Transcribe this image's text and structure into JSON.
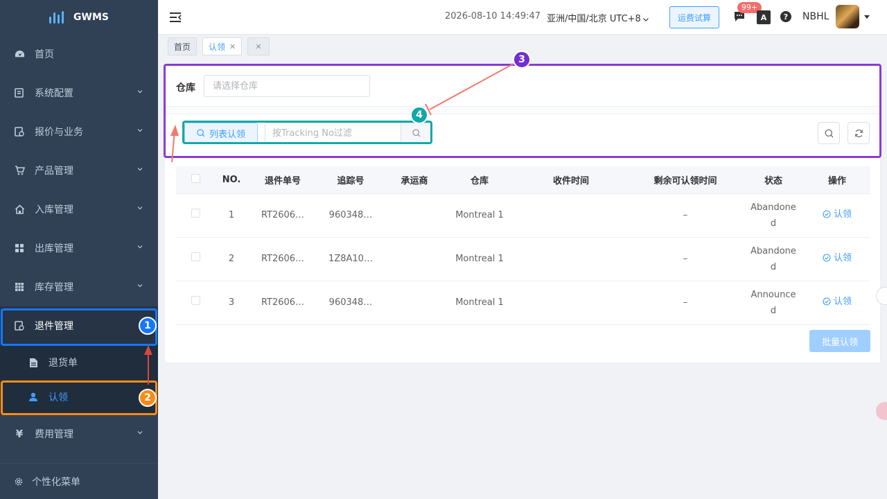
{
  "app": {
    "name": "GWMS"
  },
  "sidebar": {
    "items": [
      {
        "label": "首页",
        "icon": "dashboard-icon"
      },
      {
        "label": "系统配置",
        "icon": "config-icon"
      },
      {
        "label": "报价与业务",
        "icon": "quote-icon"
      },
      {
        "label": "产品管理",
        "icon": "cart-icon"
      },
      {
        "label": "入库管理",
        "icon": "home-icon"
      },
      {
        "label": "出库管理",
        "icon": "grid-icon"
      },
      {
        "label": "库存管理",
        "icon": "table-icon"
      },
      {
        "label": "退件管理",
        "icon": "return-icon"
      },
      {
        "label": "费用管理",
        "icon": "yen-icon"
      }
    ],
    "sub_items": [
      {
        "label": "退货单",
        "icon": "document-icon"
      },
      {
        "label": "认领",
        "icon": "user-icon"
      }
    ],
    "footer_label": "个性化菜单"
  },
  "header": {
    "datetime": "2026-08-10 14:49:47",
    "timezone": "亚洲/中国/北京 UTC+8",
    "calc_button": "运费试算",
    "badge": "99+",
    "lang_glyph": "A",
    "help_glyph": "?",
    "username": "NBHL"
  },
  "tags": [
    {
      "label": "首页"
    },
    {
      "label": "认领"
    }
  ],
  "filter": {
    "warehouse_label": "仓库",
    "warehouse_placeholder": "请选择仓库",
    "list_claim_button": "列表认领",
    "tracking_placeholder": "按Tracking No过滤"
  },
  "table": {
    "headers": [
      "NO.",
      "退件单号",
      "追踪号",
      "承运商",
      "仓库",
      "收件时间",
      "剩余可认领时间",
      "状态",
      "操作"
    ],
    "rows": [
      {
        "no": "1",
        "return_no": "RT2606…",
        "tracking": "960348…",
        "carrier": "",
        "warehouse": "Montreal 1",
        "received": "",
        "remaining": "–",
        "status": "Abandoned",
        "action": "认领"
      },
      {
        "no": "2",
        "return_no": "RT2606…",
        "tracking": "1Z8A10…",
        "carrier": "",
        "warehouse": "Montreal 1",
        "received": "",
        "remaining": "–",
        "status": "Abandoned",
        "action": "认领"
      },
      {
        "no": "3",
        "return_no": "RT2606…",
        "tracking": "960348…",
        "carrier": "",
        "warehouse": "Montreal 1",
        "received": "",
        "remaining": "–",
        "status": "Announced",
        "action": "认领"
      }
    ],
    "batch_button": "批量认领"
  },
  "annotations": [
    {
      "num": "1",
      "color": "#1677ff"
    },
    {
      "num": "2",
      "color": "#fa8c16"
    },
    {
      "num": "3",
      "color": "#722ed1"
    },
    {
      "num": "4",
      "color": "#13a8a8"
    }
  ],
  "colors": {
    "sidebar_bg": "#304156",
    "primary": "#409eff"
  }
}
